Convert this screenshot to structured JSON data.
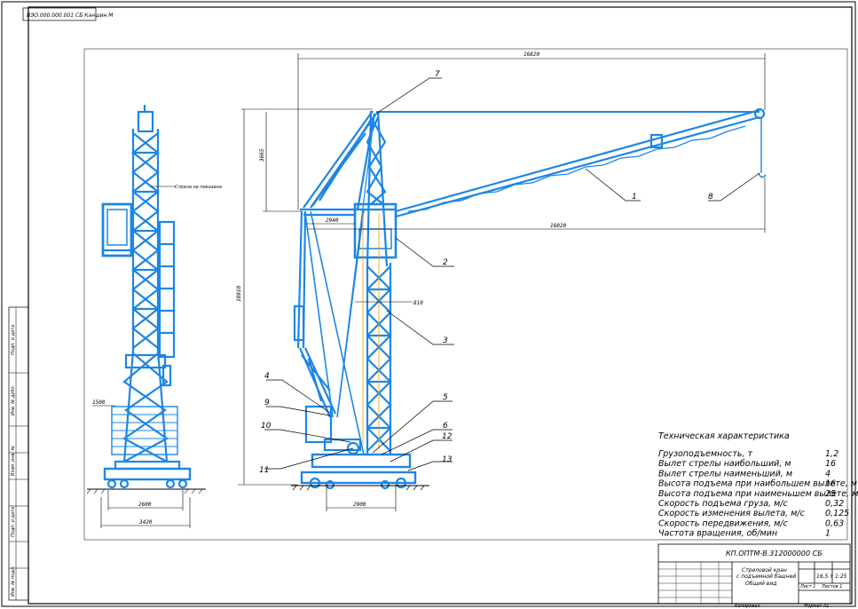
{
  "stamp": "ВЭО.000.000.001 СБ Каншин М",
  "front_note": "Стрела не показана",
  "dimensions": {
    "span_top": "16820",
    "height_vert": "3665",
    "total_height": "18910",
    "boom_reach": "16020",
    "offset_small": "2940",
    "mast_width": "810",
    "track_gauge": "2900",
    "front_width": "2600",
    "front_base": "3420",
    "front_platform": "1500"
  },
  "callouts": [
    "1",
    "2",
    "3",
    "4",
    "5",
    "6",
    "7",
    "8",
    "9",
    "10",
    "11",
    "12",
    "13"
  ],
  "specs": {
    "title": "Техническая характеристика",
    "rows": [
      {
        "label": "Грузоподъемность, т",
        "value": "1,2"
      },
      {
        "label": "Вылет стрелы наибольший, м",
        "value": "16"
      },
      {
        "label": "Вылет стрелы наименьший, м",
        "value": "4"
      },
      {
        "label": "Высота подъема при наибольшем вылете, м",
        "value": "16"
      },
      {
        "label": "Высота подъема при наименьшем вылете, м",
        "value": "25"
      },
      {
        "label": "Скорость подъема груза, м/с",
        "value": "0,32"
      },
      {
        "label": "Скорость изменения вылета, м/с",
        "value": "0,125"
      },
      {
        "label": "Скорость передвижения, м/с",
        "value": "0,63"
      },
      {
        "label": "Частота вращения, об/мин",
        "value": "1"
      }
    ]
  },
  "title_block": {
    "code": "КП.ОПТМ-В.312000000 СБ",
    "name_line1": "Стреловой кран",
    "name_line2": "с подъемной башней",
    "name_line3": "Общий вид",
    "scale": "1:25",
    "mass": "16,5 т",
    "sheet": "Лист 1",
    "sheets": "Листов 1",
    "bottom_left": "Копировал",
    "bottom_right": "Формат A1"
  },
  "side_stamp": [
    "Подп. и дата",
    "Инв. № дубл.",
    "Взам. инв. №",
    "Подп. и дата",
    "Инв. № подл."
  ],
  "colors": {
    "steel": "#1d86e5",
    "line": "#000000",
    "orange": "#ff9900"
  }
}
